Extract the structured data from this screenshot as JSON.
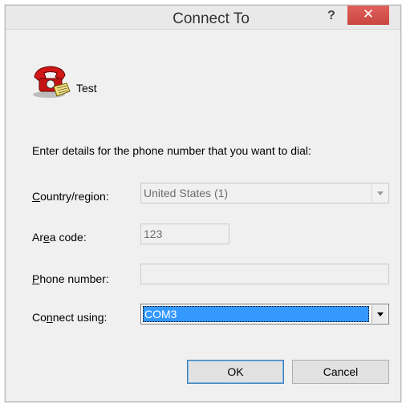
{
  "window": {
    "title": "Connect To",
    "help_label": "?",
    "close_label": "✕"
  },
  "entry": {
    "name": "Test",
    "icon": "phone-connection-icon"
  },
  "instruction": "Enter details for the phone number that you want to dial:",
  "fields": {
    "country": {
      "label_pre": "",
      "label_u": "C",
      "label_post": "ountry/region:",
      "value": "United States (1)"
    },
    "area_code": {
      "label_pre": "Ar",
      "label_u": "e",
      "label_post": "a code:",
      "value": "123"
    },
    "phone": {
      "label_pre": "",
      "label_u": "P",
      "label_post": "hone number:",
      "value": ""
    },
    "connect_using": {
      "label_pre": "Co",
      "label_u": "n",
      "label_post": "nect using:",
      "value": "COM3"
    }
  },
  "buttons": {
    "ok": "OK",
    "cancel": "Cancel"
  },
  "colors": {
    "close": "#d9534f",
    "selection": "#3399ff"
  }
}
